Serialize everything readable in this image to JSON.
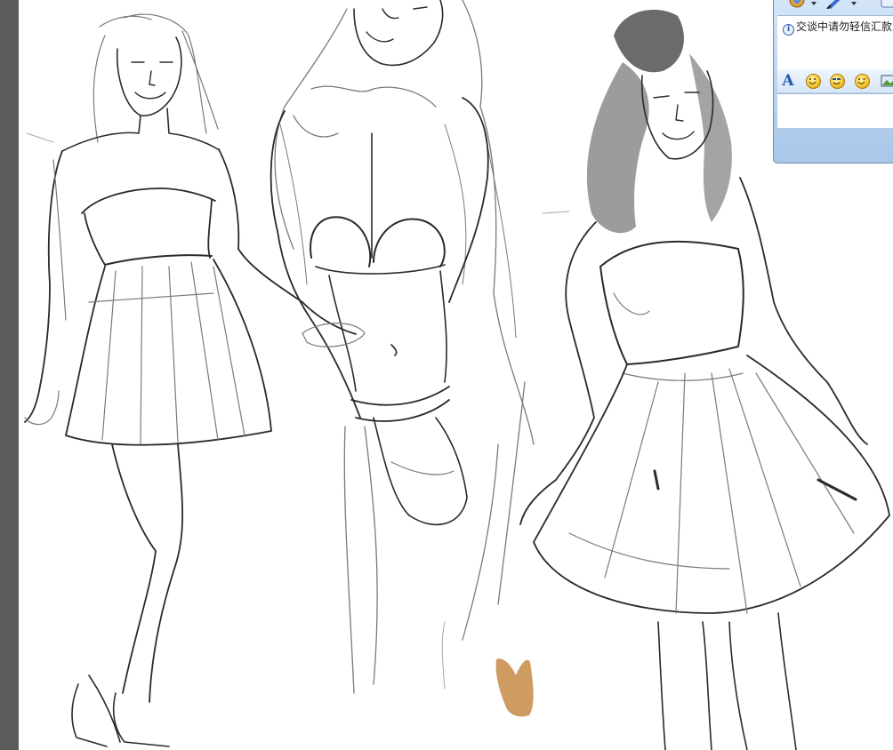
{
  "chat": {
    "notice_text": "交谈中请勿轻信汇款"
  },
  "colors": {
    "app_edge": "#5c5c5c",
    "canvas": "#ffffff",
    "sketch_stroke": "#2a2a2a",
    "brush_swatch": "#c9914f",
    "chat_frame": "#b7d1ee"
  },
  "icons": {
    "toolbar": [
      "webcam-icon",
      "dropdown-arrow-icon",
      "pen-tool-icon",
      "dropdown-arrow-icon",
      "window-icon"
    ],
    "format_bar": [
      "font-icon",
      "emoticon-icon",
      "magic-emoticon-icon",
      "wink-emoticon-icon",
      "image-icon"
    ]
  }
}
